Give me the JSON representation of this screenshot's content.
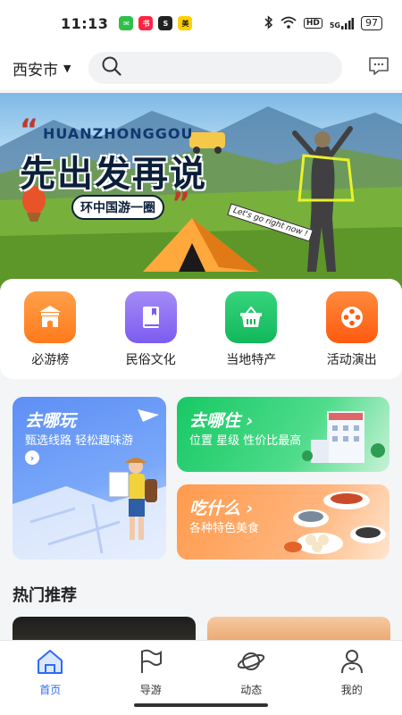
{
  "status_bar": {
    "time": "11:13",
    "network": "5G",
    "battery": "97",
    "app_icons": [
      {
        "name": "messages-app",
        "color": "#2fbf4a"
      },
      {
        "name": "xiaohongshu-app",
        "color": "#ff2442",
        "text": "小红书"
      },
      {
        "name": "app-s",
        "color": "#222",
        "text": "S"
      },
      {
        "name": "meituan-app",
        "color": "#ffd100",
        "text": "美团"
      }
    ]
  },
  "header": {
    "city": "西安市",
    "search_placeholder": ""
  },
  "banner": {
    "tag": "HUANZHONGGOU",
    "headline": "先出发再说",
    "subline": "环中国游一圈",
    "sign_text": "Let's go right now !"
  },
  "categories": [
    {
      "label": "必游榜",
      "icon": "landmark-icon",
      "color": "#ff8b26"
    },
    {
      "label": "民俗文化",
      "icon": "book-icon",
      "color": "#8a6cf2"
    },
    {
      "label": "当地特产",
      "icon": "basket-icon",
      "color": "#1fc468"
    },
    {
      "label": "活动演出",
      "icon": "film-reel-icon",
      "color": "#ff6a1a"
    }
  ],
  "features": {
    "where_play": {
      "title": "去哪玩",
      "subtitle": "甄选线路 轻松趣味游"
    },
    "where_stay": {
      "title": "去哪住",
      "subtitle": "位置 星级 性价比最高"
    },
    "what_eat": {
      "title": "吃什么",
      "subtitle": "各种特色美食"
    }
  },
  "recommend": {
    "title": "热门推荐"
  },
  "tabs": [
    {
      "label": "首页",
      "icon": "home-icon",
      "active": true
    },
    {
      "label": "导游",
      "icon": "flag-icon",
      "active": false
    },
    {
      "label": "动态",
      "icon": "planet-icon",
      "active": false
    },
    {
      "label": "我的",
      "icon": "user-icon",
      "active": false
    }
  ]
}
